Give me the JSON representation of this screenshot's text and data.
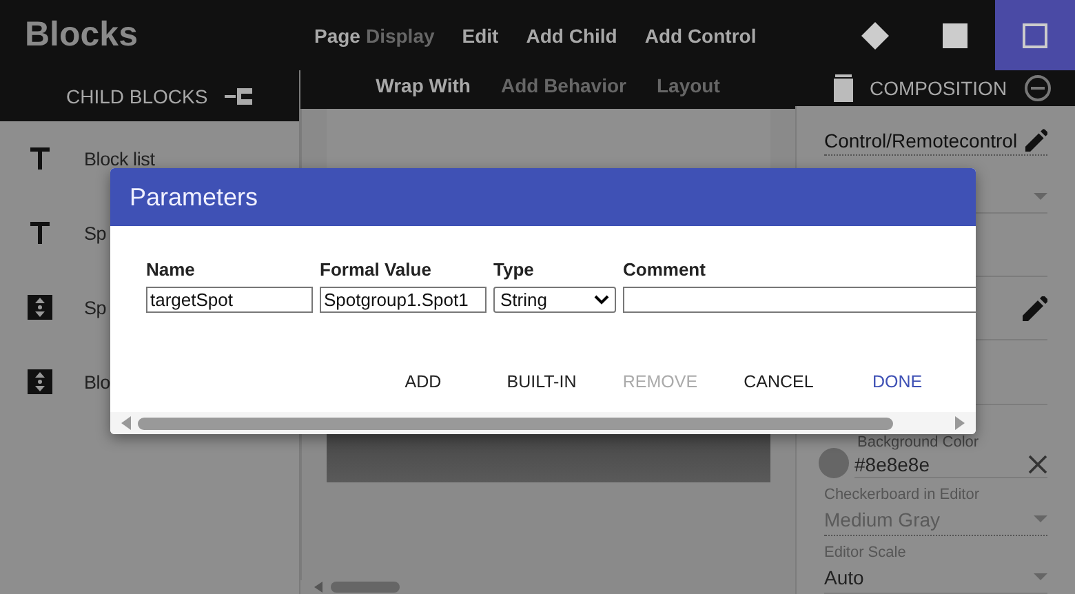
{
  "app": {
    "logo": "Blocks"
  },
  "menu": [
    {
      "label": "Page",
      "suffix": "Display",
      "disabled": false
    },
    {
      "label": "Edit",
      "disabled": false
    },
    {
      "label": "Add Child",
      "disabled": false
    },
    {
      "label": "Add Control",
      "disabled": false
    }
  ],
  "toolbar": [
    {
      "kind": "diamond",
      "selected": false
    },
    {
      "kind": "square",
      "selected": false
    },
    {
      "kind": "outline",
      "selected": true
    }
  ],
  "left_header": {
    "title": "CHILD BLOCKS"
  },
  "submenu": [
    {
      "label": "Wrap With",
      "disabled": false
    },
    {
      "label": "Add Behavior",
      "disabled": true
    },
    {
      "label": "Layout",
      "disabled": true
    }
  ],
  "right_header": {
    "title": "COMPOSITION"
  },
  "blocks": [
    {
      "kind": "text",
      "label": "Block list"
    },
    {
      "kind": "text",
      "label": "Sp"
    },
    {
      "kind": "updown",
      "label": "Sp"
    },
    {
      "kind": "updown",
      "label": "Blo"
    }
  ],
  "properties": [
    {
      "kind": "heading",
      "value": "Control/Remotecontrol"
    },
    {
      "kind": "dropdown"
    },
    {
      "kind": "blank"
    },
    {
      "kind": "edit"
    },
    {
      "kind": "blank"
    },
    {
      "kind": "color",
      "label": "Background Color",
      "value": "#8e8e8e"
    },
    {
      "kind": "dropdown",
      "label": "Checkerboard in Editor",
      "value": "Medium Gray",
      "disabled": true
    },
    {
      "kind": "dropdown",
      "label": "Editor Scale",
      "value": "Auto",
      "disabled": false
    }
  ],
  "dialog": {
    "title": "Parameters",
    "columns": [
      "Name",
      "Formal Value",
      "Type",
      "Comment"
    ],
    "row": {
      "name": "targetSpot",
      "formal_value": "Spotgroup1.Spot1",
      "type": "String"
    },
    "buttons": [
      {
        "label": "ADD",
        "disabled": false,
        "primary": false
      },
      {
        "label": "BUILT-IN",
        "disabled": false,
        "primary": false
      },
      {
        "label": "REMOVE",
        "disabled": true,
        "primary": false
      },
      {
        "label": "CANCEL",
        "disabled": false,
        "primary": false
      },
      {
        "label": "DONE",
        "disabled": false,
        "primary": true
      }
    ]
  }
}
